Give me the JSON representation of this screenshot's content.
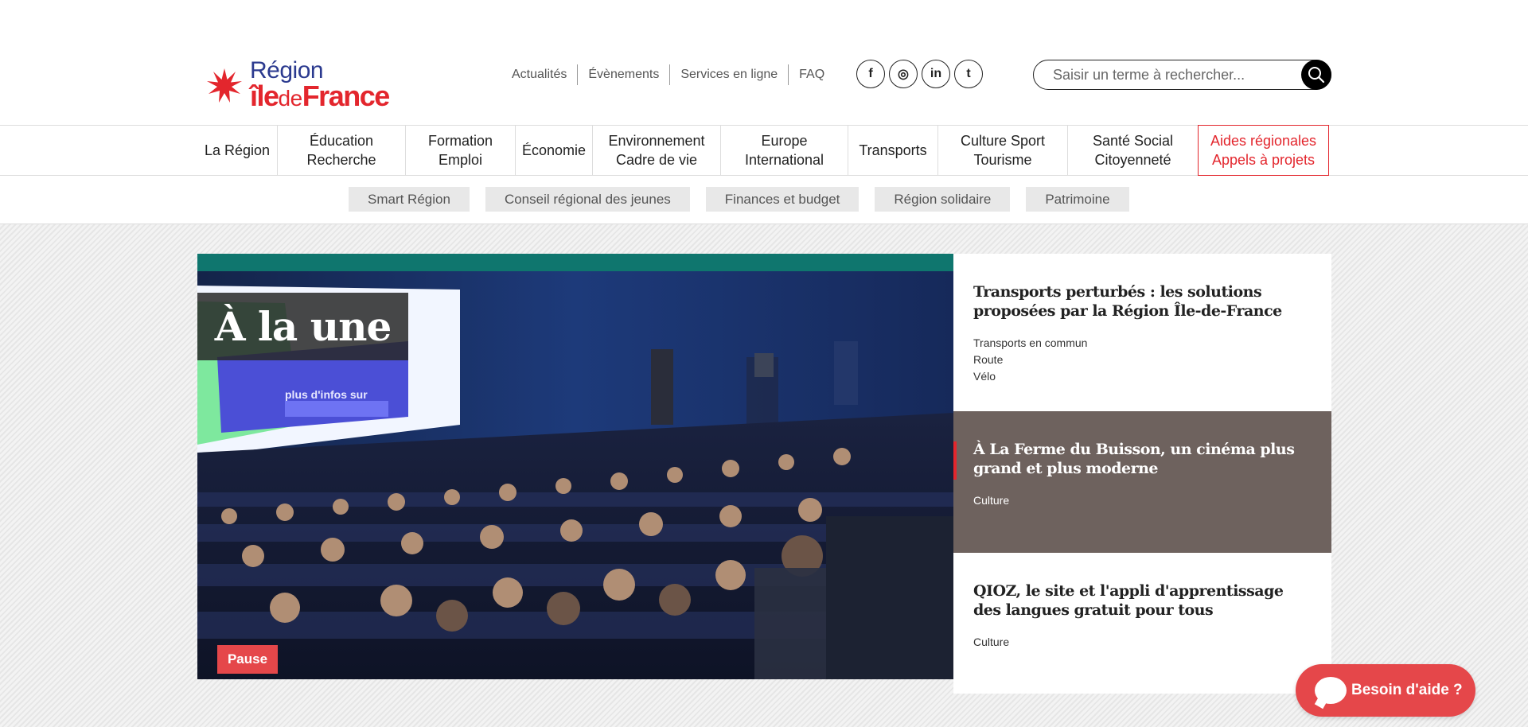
{
  "logo": {
    "line1": "Région",
    "ile": "île",
    "de": "de",
    "france": "France"
  },
  "toplinks": [
    "Actualités",
    "Évènements",
    "Services en ligne",
    "FAQ"
  ],
  "social": [
    "f",
    "◎",
    "in",
    "t"
  ],
  "search": {
    "placeholder": "Saisir un terme à rechercher..."
  },
  "mainnav": [
    {
      "label": "La Région"
    },
    {
      "label": "Éducation\nRecherche"
    },
    {
      "label": "Formation\nEmploi"
    },
    {
      "label": "Économie"
    },
    {
      "label": "Environnement\nCadre de vie"
    },
    {
      "label": "Europe\nInternational"
    },
    {
      "label": "Transports"
    },
    {
      "label": "Culture Sport\nTourisme"
    },
    {
      "label": "Santé Social\nCitoyenneté"
    },
    {
      "label": "Aides régionales\nAppels à projets"
    }
  ],
  "subnav": [
    "Smart Région",
    "Conseil régional des jeunes",
    "Finances et budget",
    "Région solidaire",
    "Patrimoine"
  ],
  "hero": {
    "heading": "À la une",
    "pause": "Pause",
    "screen_text": "plus d'infos sur"
  },
  "news": [
    {
      "title": "Transports perturbés : les solutions proposées par la Région Île-de-France",
      "tags": [
        "Transports en commun",
        "Route",
        "Vélo"
      ]
    },
    {
      "title": "À La Ferme du Buisson, un cinéma plus grand et plus moderne",
      "tags": [
        "Culture"
      ]
    },
    {
      "title": "QIOZ, le site et l'appli d'apprentissage des langues gratuit pour tous",
      "tags": [
        "Culture"
      ]
    }
  ],
  "help": {
    "label": "Besoin d'aide ?"
  },
  "colors": {
    "accent": "#e3262d",
    "brand_blue": "#2b3a8f",
    "active_news_bg": "#6e625e",
    "button_red": "#e5474a"
  }
}
